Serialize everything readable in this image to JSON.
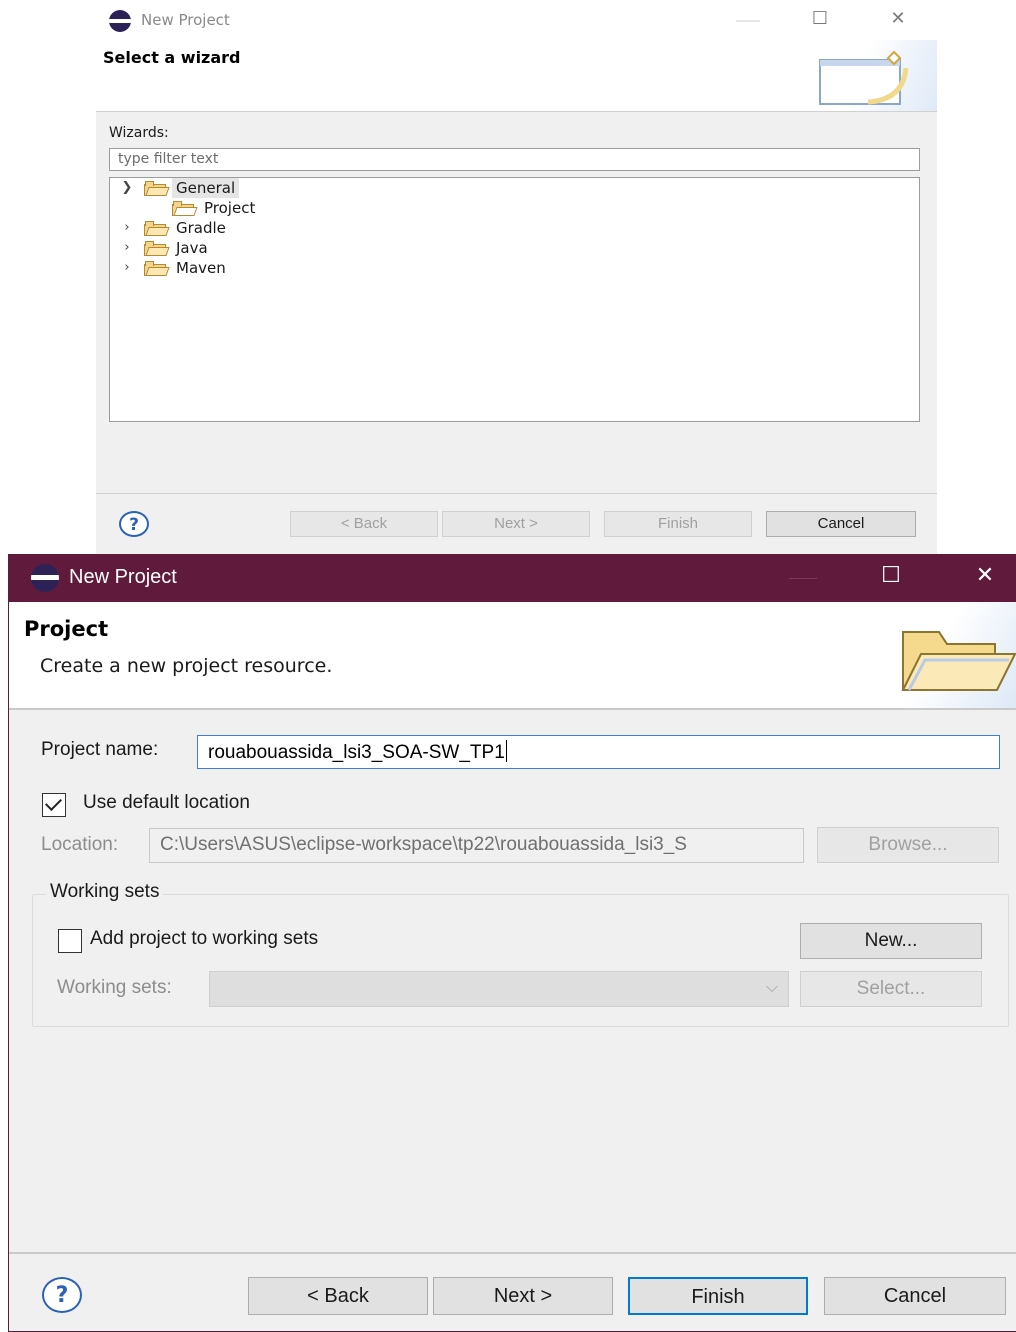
{
  "dialog1": {
    "window_title": "New Project",
    "header_title": "Select a wizard",
    "wizards_label": "Wizards:",
    "filter_placeholder": "type filter text",
    "tree": [
      {
        "label": "General",
        "expanded": true,
        "selected": true,
        "children": [
          {
            "label": "Project"
          }
        ]
      },
      {
        "label": "Gradle",
        "expanded": false
      },
      {
        "label": "Java",
        "expanded": false
      },
      {
        "label": "Maven",
        "expanded": false
      }
    ],
    "buttons": {
      "back": "< Back",
      "next": "Next >",
      "finish": "Finish",
      "cancel": "Cancel"
    },
    "help": "?"
  },
  "dialog2": {
    "window_title": "New Project",
    "header_title": "Project",
    "header_description": "Create a new project resource.",
    "project_name_label": "Project name:",
    "project_name_value": "rouabouassida_lsi3_SOA-SW_TP1",
    "use_default_location_label": "Use default location",
    "use_default_location_checked": true,
    "location_label": "Location:",
    "location_value": "C:\\Users\\ASUS\\eclipse-workspace\\tp22\\rouabouassida_lsi3_S",
    "browse_label": "Browse...",
    "working_sets_group": "Working sets",
    "add_to_working_sets_label": "Add project to working sets",
    "add_to_working_sets_checked": false,
    "new_label": "New...",
    "working_sets_label": "Working sets:",
    "select_label": "Select...",
    "buttons": {
      "back": "< Back",
      "next": "Next >",
      "finish": "Finish",
      "cancel": "Cancel"
    },
    "help": "?"
  },
  "colors": {
    "titlebar_active": "#5f1a3c",
    "accent_blue": "#0078d7",
    "dialog_bg": "#f0f0f0"
  },
  "icons": [
    "eclipse-icon",
    "minimize-icon",
    "maximize-icon",
    "close-icon",
    "folder-icon",
    "project-icon",
    "help-icon",
    "checkbox-icon",
    "chevron-down-icon"
  ]
}
